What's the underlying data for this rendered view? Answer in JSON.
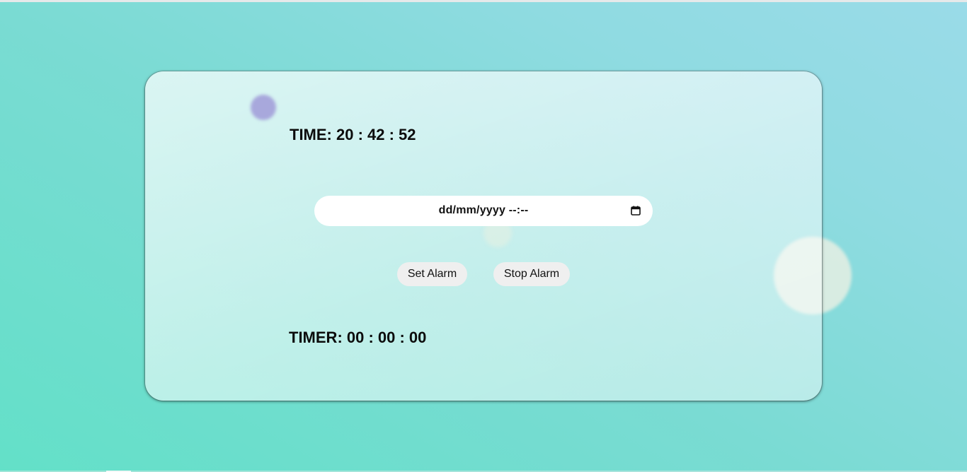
{
  "clock": {
    "time_text": "TIME: 20 : 42 : 52"
  },
  "alarm": {
    "datetime_placeholder": "dd/mm/yyyy --:--",
    "set_label": "Set Alarm",
    "stop_label": "Stop Alarm"
  },
  "timer": {
    "timer_text": "TIMER: 00 : 00 : 00"
  },
  "icons": {
    "calendar": "calendar-icon"
  },
  "colors": {
    "background_start": "#63e0c8",
    "background_end": "#9adbe8",
    "button_bg": "#efefef",
    "field_bg": "#ffffff",
    "accent_blob": "#a8a8dc"
  }
}
